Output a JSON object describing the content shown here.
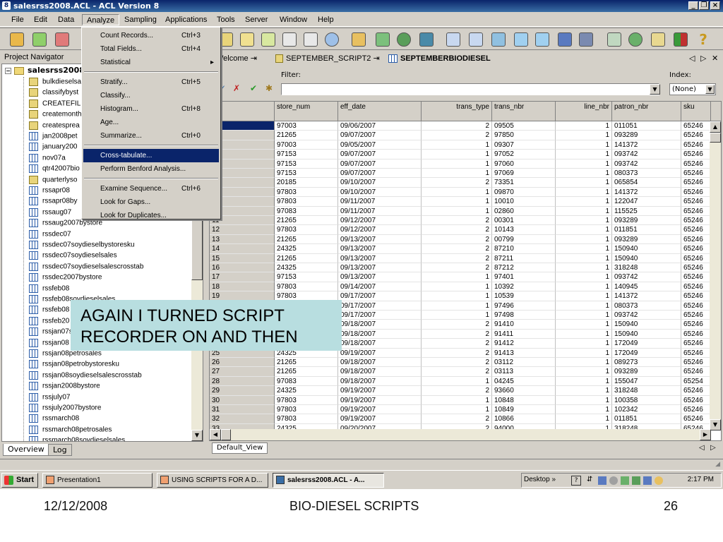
{
  "window": {
    "title": "salesrss2008.ACL - ACL Version 8",
    "icon_text": "8"
  },
  "menu": [
    "File",
    "Edit",
    "Data",
    "Analyze",
    "Sampling",
    "Applications",
    "Tools",
    "Server",
    "Window",
    "Help"
  ],
  "navigator": {
    "title": "Project Navigator",
    "root": "salesrss2008",
    "items": [
      {
        "label": "bulkdieselsa",
        "type": "script"
      },
      {
        "label": "classifybyst",
        "type": "script"
      },
      {
        "label": "CREATEFIL",
        "type": "script"
      },
      {
        "label": "createmonth",
        "type": "script"
      },
      {
        "label": "createsprea",
        "type": "script"
      },
      {
        "label": "jan2008pet",
        "type": "table"
      },
      {
        "label": "january200",
        "type": "table"
      },
      {
        "label": "nov07a",
        "type": "table"
      },
      {
        "label": "qtr42007bio",
        "type": "table"
      },
      {
        "label": "quarterlyso",
        "type": "script"
      },
      {
        "label": "rssapr08",
        "type": "table"
      },
      {
        "label": "rssapr08by",
        "type": "table"
      },
      {
        "label": "rssaug07",
        "type": "table"
      },
      {
        "label": "rssaug2007bystore",
        "type": "table"
      },
      {
        "label": "rssdec07",
        "type": "table"
      },
      {
        "label": "rssdec07soydieselbystoresku",
        "type": "table"
      },
      {
        "label": "rssdec07soydieselsales",
        "type": "table"
      },
      {
        "label": "rssdec07soydieselsalescrosstab",
        "type": "table"
      },
      {
        "label": "rssdec2007bystore",
        "type": "table"
      },
      {
        "label": "rssfeb08",
        "type": "table"
      },
      {
        "label": "rssfeb08soydieselsales",
        "type": "table"
      },
      {
        "label": "rssfeb08",
        "type": "table"
      },
      {
        "label": "rssfeb20",
        "type": "table"
      },
      {
        "label": "rssjan07s",
        "type": "table"
      },
      {
        "label": "rssjan08",
        "type": "table"
      },
      {
        "label": "rssjan08petrosales",
        "type": "table"
      },
      {
        "label": "rssjan08petrobystoresku",
        "type": "table"
      },
      {
        "label": "rssjan08soydieselsalescrosstab",
        "type": "table"
      },
      {
        "label": "rssjan2008bystore",
        "type": "table"
      },
      {
        "label": "rssjuly07",
        "type": "table"
      },
      {
        "label": "rssjuly2007bystore",
        "type": "table"
      },
      {
        "label": "rssmarch08",
        "type": "table"
      },
      {
        "label": "rssmarch08petrosales",
        "type": "table"
      },
      {
        "label": "rssmarch08soydieselsales",
        "type": "table"
      }
    ],
    "tabs": [
      "Overview",
      "Log"
    ]
  },
  "doc_tabs": [
    "Welcome",
    "SEPTEMBER_SCRIPT2",
    "SEPTEMBERBIODIESEL"
  ],
  "filter": {
    "label": "Filter:",
    "value": "",
    "index_label": "Index:",
    "index_value": "(None)"
  },
  "grid": {
    "columns": [
      "store_num",
      "eff_date",
      "trans_type",
      "trans_nbr",
      "line_nbr",
      "patron_nbr",
      "sku"
    ],
    "rows": [
      [
        "1",
        "97003",
        "09/06/2007",
        "2",
        "09505",
        "1",
        "011051",
        "65246"
      ],
      [
        "2",
        "21265",
        "09/07/2007",
        "2",
        "97850",
        "1",
        "093289",
        "65246"
      ],
      [
        "3",
        "97003",
        "09/05/2007",
        "1",
        "09307",
        "1",
        "141372",
        "65246"
      ],
      [
        "4",
        "97153",
        "09/07/2007",
        "1",
        "97052",
        "1",
        "093742",
        "65246"
      ],
      [
        "5",
        "97153",
        "09/07/2007",
        "1",
        "97060",
        "1",
        "093742",
        "65246"
      ],
      [
        "6",
        "97153",
        "09/07/2007",
        "1",
        "97069",
        "1",
        "080373",
        "65246"
      ],
      [
        "7",
        "20185",
        "09/10/2007",
        "2",
        "73351",
        "1",
        "065854",
        "65246"
      ],
      [
        "8",
        "97803",
        "09/10/2007",
        "1",
        "09870",
        "1",
        "141372",
        "65246"
      ],
      [
        "9",
        "97803",
        "09/11/2007",
        "1",
        "10010",
        "1",
        "122047",
        "65246"
      ],
      [
        "10",
        "97083",
        "09/11/2007",
        "1",
        "02860",
        "1",
        "115525",
        "65246"
      ],
      [
        "11",
        "21265",
        "09/12/2007",
        "2",
        "00301",
        "1",
        "093289",
        "65246"
      ],
      [
        "12",
        "97803",
        "09/12/2007",
        "2",
        "10143",
        "1",
        "011851",
        "65246"
      ],
      [
        "13",
        "21265",
        "09/13/2007",
        "2",
        "00799",
        "1",
        "093289",
        "65246"
      ],
      [
        "14",
        "24325",
        "09/13/2007",
        "2",
        "87210",
        "1",
        "150940",
        "65246"
      ],
      [
        "15",
        "21265",
        "09/13/2007",
        "2",
        "87211",
        "1",
        "150940",
        "65246"
      ],
      [
        "16",
        "24325",
        "09/13/2007",
        "2",
        "87212",
        "1",
        "318248",
        "65246"
      ],
      [
        "17",
        "97153",
        "09/13/2007",
        "1",
        "97401",
        "1",
        "093742",
        "65246"
      ],
      [
        "18",
        "97803",
        "09/14/2007",
        "1",
        "10392",
        "1",
        "140945",
        "65246"
      ],
      [
        "19",
        "97803",
        "09/17/2007",
        "1",
        "10539",
        "1",
        "141372",
        "65246"
      ],
      [
        "20",
        "97153",
        "09/17/2007",
        "1",
        "97496",
        "1",
        "080373",
        "65246"
      ],
      [
        "21",
        "97153",
        "09/17/2007",
        "1",
        "97498",
        "1",
        "093742",
        "65246"
      ],
      [
        "22",
        "24325",
        "09/18/2007",
        "2",
        "91410",
        "1",
        "150940",
        "65246"
      ],
      [
        "23",
        "24325",
        "09/18/2007",
        "2",
        "91411",
        "1",
        "150940",
        "65246"
      ],
      [
        "24",
        "24325",
        "09/18/2007",
        "2",
        "91412",
        "1",
        "172049",
        "65246"
      ],
      [
        "25",
        "24325",
        "09/19/2007",
        "2",
        "91413",
        "1",
        "172049",
        "65246"
      ],
      [
        "26",
        "21265",
        "09/18/2007",
        "2",
        "03112",
        "1",
        "089273",
        "65246"
      ],
      [
        "27",
        "21265",
        "09/18/2007",
        "2",
        "03113",
        "1",
        "093289",
        "65246"
      ],
      [
        "28",
        "97083",
        "09/18/2007",
        "1",
        "04245",
        "1",
        "155047",
        "65254"
      ],
      [
        "29",
        "24325",
        "09/19/2007",
        "2",
        "93660",
        "1",
        "318248",
        "65246"
      ],
      [
        "30",
        "97803",
        "09/19/2007",
        "1",
        "10848",
        "1",
        "100358",
        "65246"
      ],
      [
        "31",
        "97803",
        "09/19/2007",
        "1",
        "10849",
        "1",
        "102342",
        "65246"
      ],
      [
        "32",
        "97803",
        "09/19/2007",
        "2",
        "10866",
        "1",
        "011851",
        "65246"
      ],
      [
        "33",
        "24325",
        "09/20/2007",
        "2",
        "94000",
        "1",
        "318248",
        "65246"
      ]
    ]
  },
  "view_tab": "Default_View",
  "analyze_menu": {
    "groups": [
      [
        {
          "label": "Count Records...",
          "shortcut": "Ctrl+3"
        },
        {
          "label": "Total Fields...",
          "shortcut": "Ctrl+4"
        },
        {
          "label": "Statistical",
          "shortcut": "",
          "submenu": "▸"
        }
      ],
      [
        {
          "label": "Stratify...",
          "shortcut": "Ctrl+5"
        },
        {
          "label": "Classify...",
          "shortcut": ""
        },
        {
          "label": "Histogram...",
          "shortcut": "Ctrl+8"
        },
        {
          "label": "Age...",
          "shortcut": ""
        },
        {
          "label": "Summarize...",
          "shortcut": "Ctrl+0"
        }
      ],
      [
        {
          "label": "Cross-tabulate...",
          "shortcut": "",
          "highlighted": true
        },
        {
          "label": "Perform Benford Analysis...",
          "shortcut": ""
        }
      ],
      [
        {
          "label": "Examine Sequence...",
          "shortcut": "Ctrl+6"
        },
        {
          "label": "Look for Gaps...",
          "shortcut": ""
        },
        {
          "label": "Look for Duplicates...",
          "shortcut": ""
        }
      ]
    ]
  },
  "callout": {
    "line1": "AGAIN I TURNED SCRIPT",
    "line2": "RECORDER ON AND THEN"
  },
  "taskbar": {
    "start": "Start",
    "tasks": [
      "Presentation1",
      "USING SCRIPTS FOR A D...",
      "salesrss2008.ACL - A..."
    ],
    "desktop": "Desktop",
    "clock": "2:17 PM"
  },
  "footer": {
    "date": "12/12/2008",
    "title": "BIO-DIESEL SCRIPTS",
    "page": "26"
  },
  "colors": {
    "title_bar": "#0a246a",
    "highlight": "#0a246a",
    "callout": "#b8dee0",
    "chrome": "#d4d0c8"
  }
}
